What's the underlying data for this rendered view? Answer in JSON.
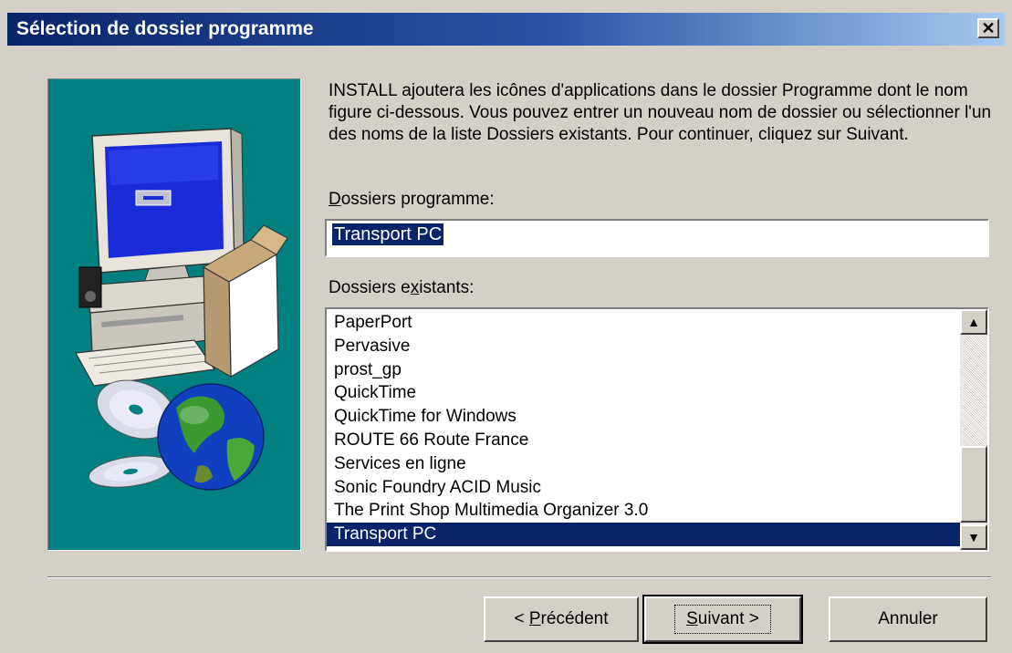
{
  "window": {
    "title": "Sélection de dossier programme",
    "close_symbol": "✕"
  },
  "description": "INSTALL ajoutera les icônes d'applications dans le dossier Programme dont le nom figure ci-dessous. Vous pouvez entrer un nouveau nom de dossier ou sélectionner l'un des noms de la liste Dossiers existants. Pour continuer, cliquez sur Suivant.",
  "program_folder": {
    "label_first": "D",
    "label_rest": "ossiers programme:",
    "value": "Transport PC"
  },
  "existing_folders": {
    "label_before": "Dossiers e",
    "label_underlined": "x",
    "label_after": "istants:",
    "items": [
      "PaperPort",
      "Pervasive",
      "prost_gp",
      "QuickTime",
      "QuickTime for Windows",
      "ROUTE 66 Route France",
      "Services en ligne",
      "Sonic Foundry ACID Music",
      "The Print Shop Multimedia Organizer 3.0",
      "Transport PC"
    ],
    "selected_index": 9
  },
  "scrollbar": {
    "up_symbol": "▲",
    "down_symbol": "▼"
  },
  "buttons": {
    "back_prefix": "< ",
    "back_underlined": "P",
    "back_rest": "récédent",
    "next_underlined": "S",
    "next_rest": "uivant >",
    "cancel": "Annuler"
  },
  "colors": {
    "title_bar": "#0a246a",
    "selection": "#0a246a",
    "art_background": "#008080",
    "dialog_face": "#d4d0c8"
  },
  "icons": [
    "computer-icon",
    "package-box-icon",
    "cd-disc-icon",
    "globe-icon",
    "close-icon",
    "scroll-up-icon",
    "scroll-down-icon"
  ]
}
